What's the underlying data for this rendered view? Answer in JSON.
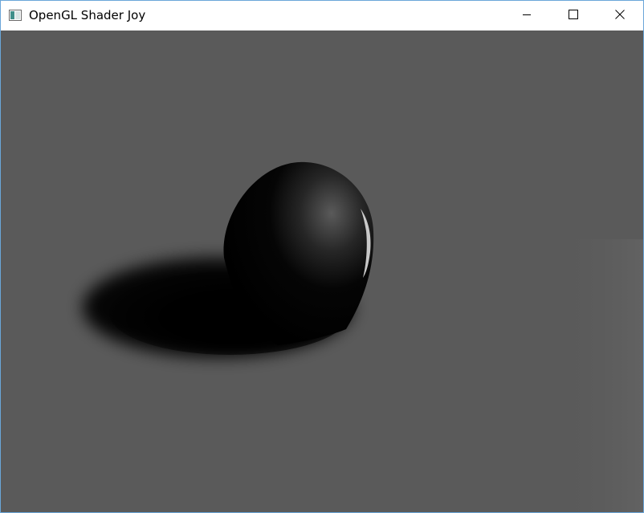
{
  "window": {
    "title": "OpenGL Shader Joy",
    "icons": {
      "app": "app-window-icon",
      "minimize": "minimize-icon",
      "maximize": "maximize-icon",
      "close": "close-icon"
    }
  },
  "scene": {
    "background_color": "#5a5a5a",
    "object": "heart",
    "object_color": "#000000"
  }
}
